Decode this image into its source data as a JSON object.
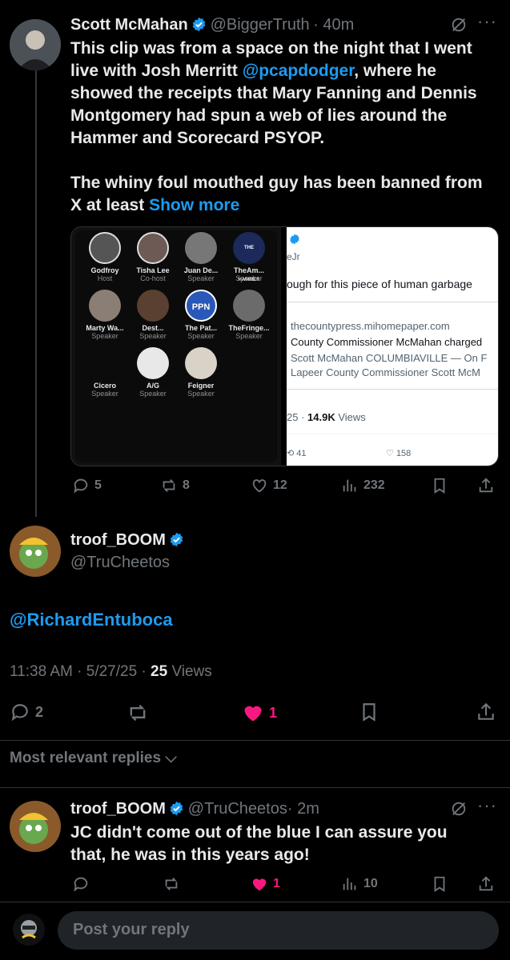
{
  "colors": {
    "accent": "#1d9bf0",
    "like": "#f91880",
    "muted": "#71767b",
    "background": "#000000"
  },
  "parent_tweet": {
    "name": "Scott McMahan",
    "handle": "@BiggerTruth",
    "time": "· 40m",
    "text_lines": [
      "This clip was from a space on the night that I went",
      "live with Josh Merritt",
      "showed the receipts that Mary Fanning and Dennis",
      "Montgomery had spun a web of lies around the",
      "Hammer and Scorecard PSYOP.",
      "The whiny foul mouthed guy has been banned from",
      "X at least"
    ],
    "mention": "@pcapdodger",
    "mention_after": ", where he",
    "show_more": "Show more",
    "stats": {
      "replies": "5",
      "reposts": "8",
      "likes": "12",
      "views": "232"
    },
    "space_speakers": [
      {
        "name": "Godfroy",
        "role": "Host"
      },
      {
        "name": "Tisha Lee",
        "role": "Co-host"
      },
      {
        "name": "Juan De...",
        "role": "Speaker"
      },
      {
        "name": "TheAm...",
        "role": "Speaker"
      },
      {
        "name": "Marty Wa...",
        "role": "Speaker"
      },
      {
        "name": "Dest...",
        "role": "Speaker"
      },
      {
        "name": "The Pat...",
        "role": "Speaker"
      },
      {
        "name": "TheFringe...",
        "role": "Speaker"
      },
      {
        "name": "Cicero",
        "role": "Speaker"
      },
      {
        "name": "A/G",
        "role": "Speaker"
      },
      {
        "name": "Feigner",
        "role": "Speaker"
      }
    ],
    "hammer_text": "THE HAMMER",
    "ppn_text": "PPN",
    "embedded": {
      "handle_fragment": "eJr",
      "text": "ough for this piece of human garbage",
      "link_domain": "thecountypress.mihomepaper.com",
      "link_title": "County Commissioner McMahan charged",
      "link_desc1": "Scott McMahan COLUMBIAVILLE — On F",
      "link_desc2": "Lapeer County Commissioner Scott McM",
      "views_prefix": "25 ·",
      "views": "14.9K",
      "views_label": "Views",
      "reposts": "41",
      "likes": "158"
    }
  },
  "main_tweet": {
    "name": "troof_BOOM",
    "handle": "@TruCheetos",
    "text": "@RichardEntuboca",
    "time": "11:38 AM · 5/27/25 ·",
    "views": "25",
    "views_label": "Views",
    "stats": {
      "replies": "2",
      "likes": "1"
    }
  },
  "replies_sort": "Most relevant replies",
  "reply": {
    "name": "troof_BOOM",
    "handle": "@TruCheetos",
    "time": "· 2m",
    "text_lines": [
      "JC didn't come out of the blue I can assure you",
      "that, he was in this years ago!"
    ],
    "stats": {
      "likes": "1",
      "views": "10"
    }
  },
  "composer": {
    "placeholder": "Post your reply"
  }
}
